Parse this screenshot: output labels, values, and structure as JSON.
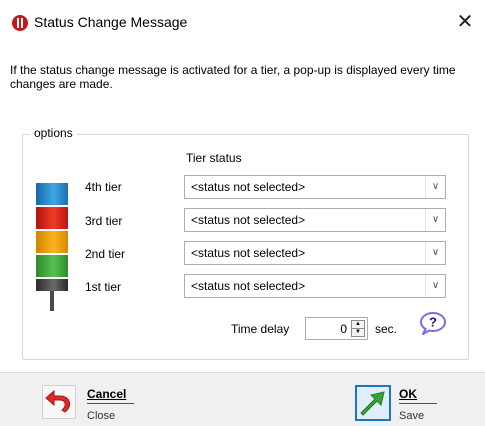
{
  "window": {
    "title": "Status Change Message",
    "close_label": "✕"
  },
  "description": "If the status change message is activated for a tier, a pop-up is displayed every time changes are made.",
  "options": {
    "group_label": "options",
    "tier_status_header": "Tier status",
    "tiers": [
      {
        "label": "4th tier",
        "status": "<status not selected>",
        "color": "#1f87d6"
      },
      {
        "label": "3rd tier",
        "status": "<status not selected>",
        "color": "#e53222"
      },
      {
        "label": "2nd tier",
        "status": "<status not selected>",
        "color": "#f7a81b"
      },
      {
        "label": "1st tier",
        "status": "<status not selected>",
        "color": "#45b043"
      }
    ],
    "time_delay": {
      "label": "Time delay",
      "value": "0",
      "unit": "sec."
    },
    "help_glyph": "?"
  },
  "footer": {
    "cancel": {
      "title": "Cancel",
      "subtitle": "Close",
      "icon": "undo-arrow-icon"
    },
    "ok": {
      "title": "OK",
      "subtitle": "Save",
      "icon": "check-arrow-icon"
    }
  },
  "colors": {
    "ok_border": "#1b75c7",
    "cancel_arrow": "#e02a2a",
    "ok_arrow": "#3aa63a",
    "help": "#6a5acd"
  }
}
